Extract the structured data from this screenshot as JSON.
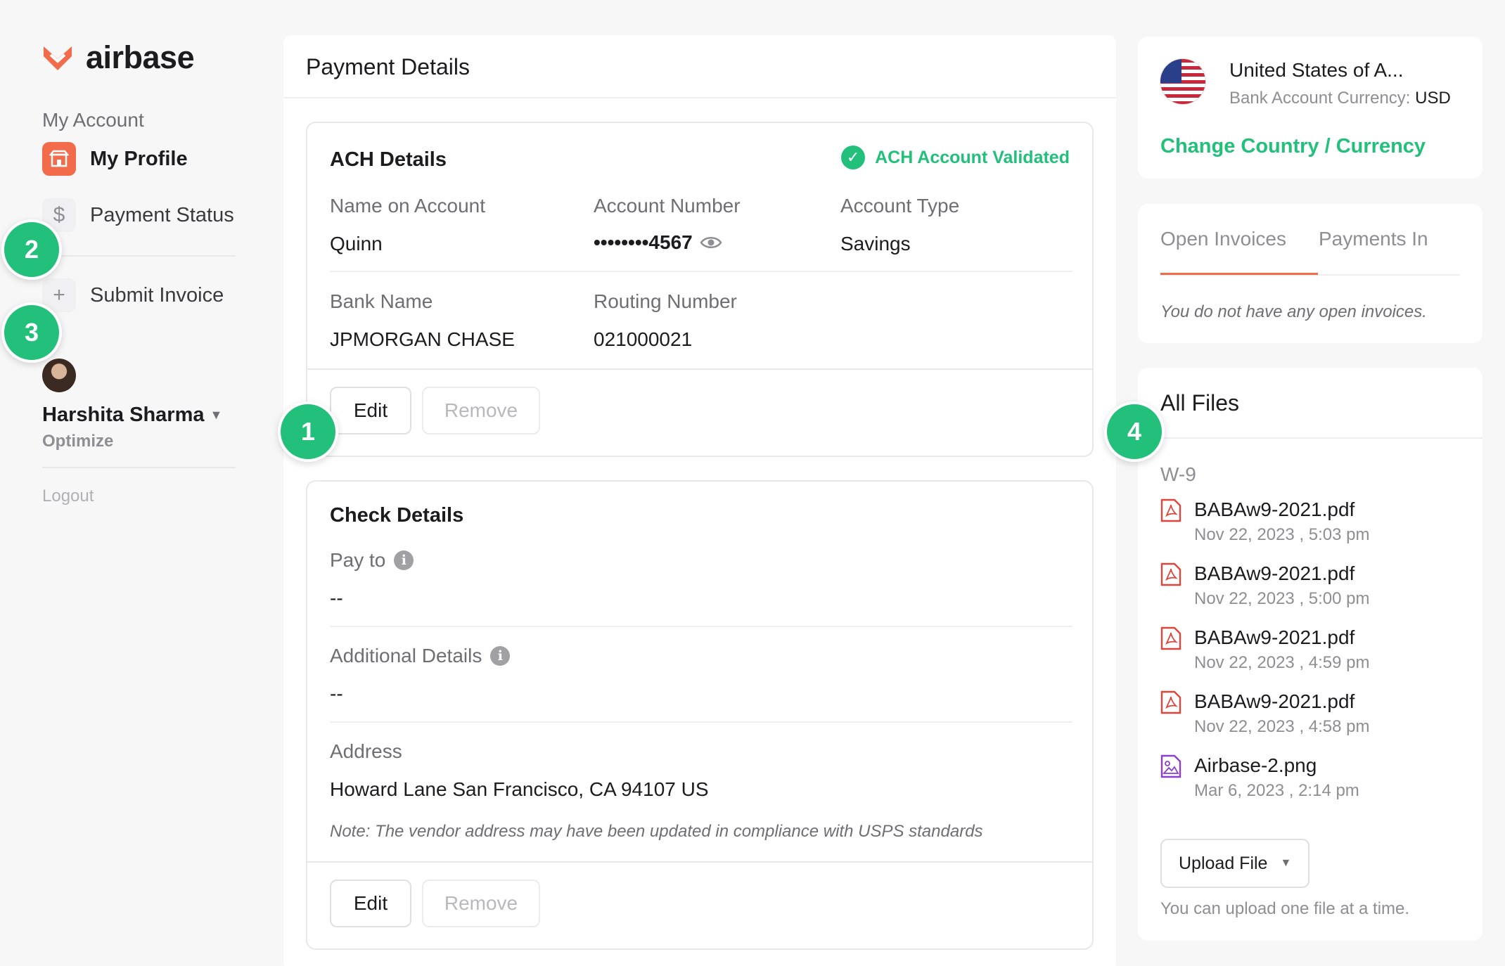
{
  "brand": {
    "name": "airbase",
    "accent": "#f26b4b",
    "success": "#22c07a"
  },
  "sidebar": {
    "section_label": "My Account",
    "items": [
      {
        "label": "My Profile",
        "icon": "store-icon",
        "active": true
      },
      {
        "label": "Payment Status",
        "icon": "dollar-icon",
        "active": false
      },
      {
        "label": "Submit Invoice",
        "icon": "plus-icon",
        "active": false
      }
    ],
    "user": {
      "name": "Harshita Sharma",
      "company": "Optimize"
    },
    "logout": "Logout"
  },
  "markers": [
    "1",
    "2",
    "3",
    "4"
  ],
  "main": {
    "title": "Payment Details",
    "ach": {
      "title": "ACH Details",
      "status": "ACH Account Validated",
      "fields": {
        "name_label": "Name on Account",
        "name_value": "Quinn",
        "account_label": "Account Number",
        "account_value": "••••••••4567",
        "type_label": "Account Type",
        "type_value": "Savings",
        "bank_label": "Bank Name",
        "bank_value": "JPMORGAN CHASE",
        "routing_label": "Routing Number",
        "routing_value": "021000021"
      },
      "edit_label": "Edit",
      "remove_label": "Remove"
    },
    "check": {
      "title": "Check Details",
      "payto_label": "Pay to",
      "payto_value": "--",
      "additional_label": "Additional Details",
      "additional_value": "--",
      "address_label": "Address",
      "address_value": "Howard Lane San Francisco, CA 94107 US",
      "note": "Note: The vendor address may have been updated in compliance with USPS standards",
      "edit_label": "Edit",
      "remove_label": "Remove"
    }
  },
  "country": {
    "name": "United States of A...",
    "currency_label": "Bank Account Currency:",
    "currency_value": "USD",
    "change_link": "Change Country / Currency"
  },
  "invoices": {
    "tabs": [
      "Open Invoices",
      "Payments In"
    ],
    "empty_message": "You do not have any open invoices."
  },
  "files": {
    "title": "All Files",
    "group": "W-9",
    "items": [
      {
        "name": "BABAw9-2021.pdf",
        "date": "Nov 22, 2023 , 5:03 pm",
        "type": "pdf"
      },
      {
        "name": "BABAw9-2021.pdf",
        "date": "Nov 22, 2023 , 5:00 pm",
        "type": "pdf"
      },
      {
        "name": "BABAw9-2021.pdf",
        "date": "Nov 22, 2023 , 4:59 pm",
        "type": "pdf"
      },
      {
        "name": "BABAw9-2021.pdf",
        "date": "Nov 22, 2023 , 4:58 pm",
        "type": "pdf"
      },
      {
        "name": "Airbase-2.png",
        "date": "Mar 6, 2023 , 2:14 pm",
        "type": "image"
      }
    ],
    "upload_label": "Upload File",
    "upload_hint": "You can upload one file at a time."
  }
}
